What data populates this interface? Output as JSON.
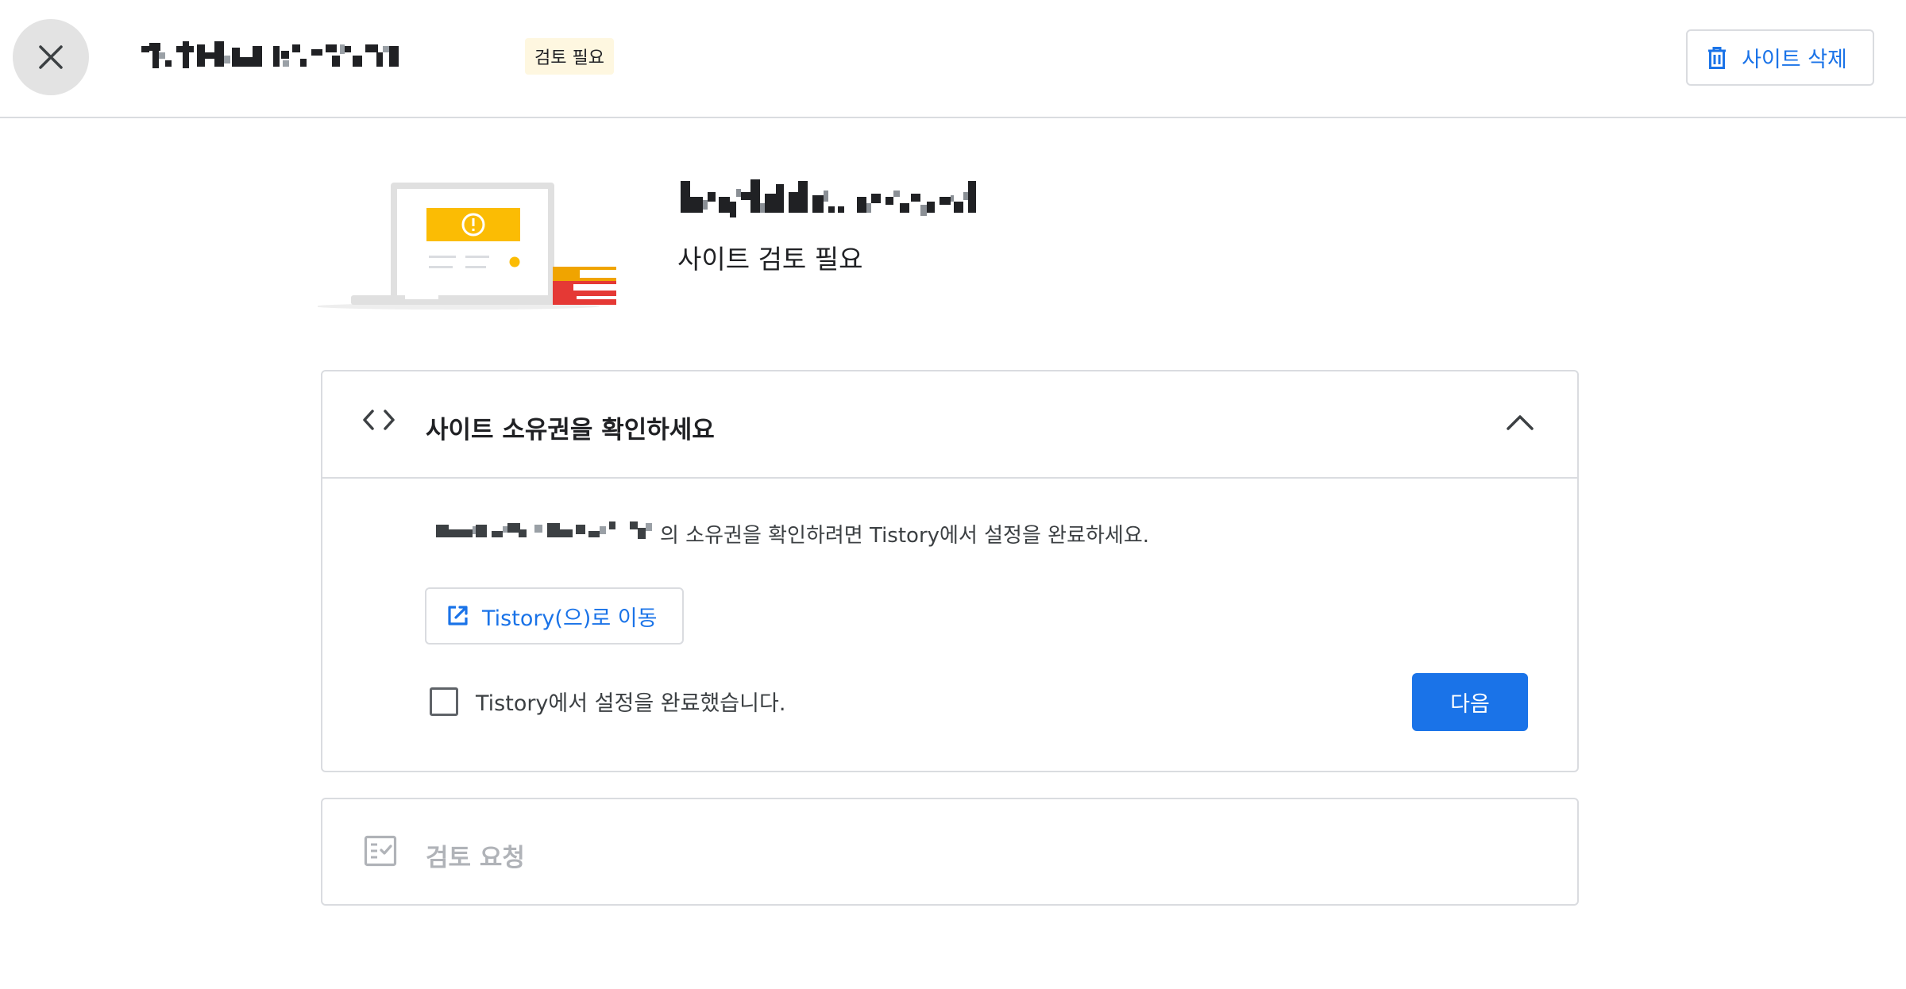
{
  "header": {
    "status_badge": "검토 필요",
    "delete_label": "사이트 삭제"
  },
  "hero": {
    "status": "사이트 검토 필요"
  },
  "verify_card": {
    "title": "사이트 소유권을 확인하세요",
    "description": "의 소유권을 확인하려면 Tistory에서 설정을 완료하세요.",
    "goto_label": "Tistory(으)로 이동",
    "checkbox_label": "Tistory에서 설정을 완료했습니다.",
    "checkbox_checked": false,
    "next_label": "다음"
  },
  "review_card": {
    "title": "검토 요청"
  },
  "icons": {
    "close": "close-icon",
    "delete": "trash-icon",
    "code": "code-icon",
    "collapse": "chevron-up-icon",
    "external": "open-in-new-icon",
    "review": "fact-check-icon"
  },
  "colors": {
    "accent": "#1a73e8",
    "badge_bg": "#fef7e0",
    "warning": "#fbbc04",
    "border": "#dadce0",
    "disabled_text": "#b0b3b8"
  }
}
